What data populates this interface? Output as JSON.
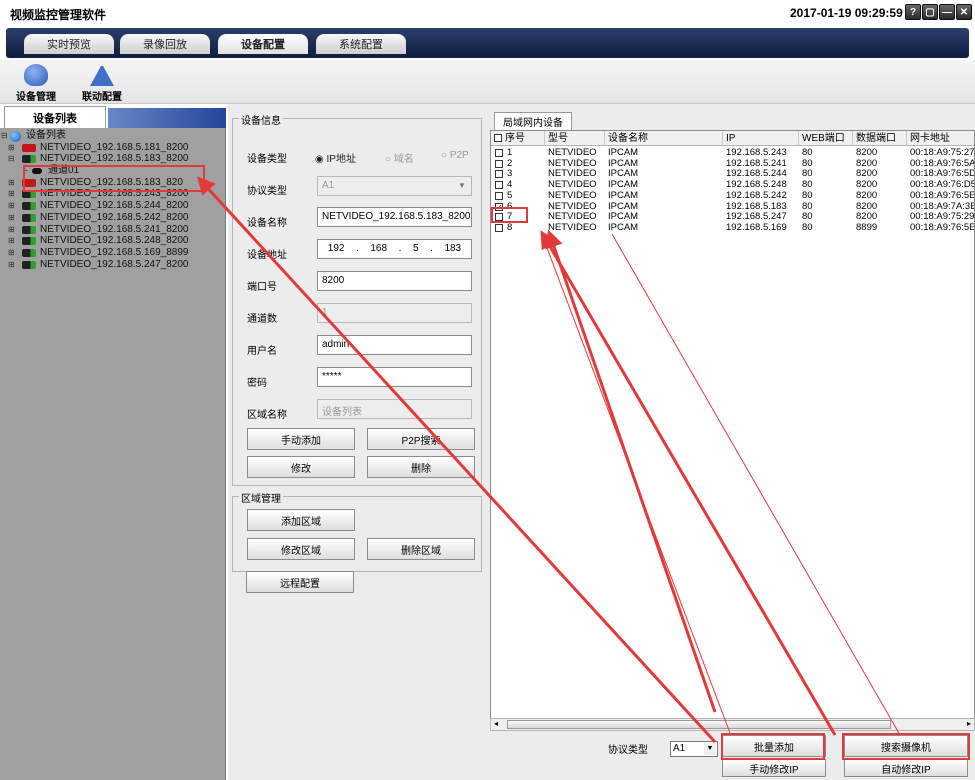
{
  "app": {
    "title": "视频监控管理软件",
    "datetime": "2017-01-19 09:29:59"
  },
  "window_buttons": [
    "?",
    "▢",
    "—",
    "✕"
  ],
  "tabs": [
    {
      "label": "实时预览"
    },
    {
      "label": "录像回放"
    },
    {
      "label": "设备配置"
    },
    {
      "label": "系统配置"
    }
  ],
  "toolbar": {
    "device_manage": "设备管理",
    "linkage_config": "联动配置"
  },
  "left": {
    "tab_label": "设备列表",
    "root": "设备列表",
    "devices": [
      {
        "name": "NETVIDEO_192.168.5.181_8200",
        "status": "red"
      },
      {
        "name": "NETVIDEO_192.168.5.183_8200",
        "status": "green"
      },
      {
        "name": "NETVIDEO_192.168.5.183_820",
        "status": "red"
      },
      {
        "name": "NETVIDEO_192.168.5.243_8200",
        "status": "green"
      },
      {
        "name": "NETVIDEO_192.168.5.244_8200",
        "status": "green"
      },
      {
        "name": "NETVIDEO_192.168.5.242_8200",
        "status": "green"
      },
      {
        "name": "NETVIDEO_192.168.5.241_8200",
        "status": "green"
      },
      {
        "name": "NETVIDEO_192.168.5.248_8200",
        "status": "green"
      },
      {
        "name": "NETVIDEO_192.168.5.169_8899",
        "status": "green"
      },
      {
        "name": "NETVIDEO_192.168.5.247_8200",
        "status": "green"
      }
    ],
    "channel": "通道01"
  },
  "device_info": {
    "group_title": "设备信息",
    "device_type_label": "设备类型",
    "type_ip": "IP地址",
    "type_domain": "域名",
    "type_p2p": "P2P",
    "protocol_label": "协议类型",
    "protocol_value": "A1",
    "name_label": "设备名称",
    "name_value": "NETVIDEO_192.168.5.183_8200",
    "address_label": "设备地址",
    "ip": [
      "192",
      "168",
      "5",
      "183"
    ],
    "port_label": "端口号",
    "port_value": "8200",
    "channels_label": "通道数",
    "channels_value": "1",
    "user_label": "用户名",
    "user_value": "admin",
    "password_label": "密码",
    "password_value": "*****",
    "area_label": "区域名称",
    "area_value": "设备列表",
    "btn_manual_add": "手动添加",
    "btn_p2p_search": "P2P搜索",
    "btn_modify": "修改",
    "btn_delete": "删除"
  },
  "area_mgmt": {
    "group_title": "区域管理",
    "btn_add": "添加区域",
    "btn_modify": "修改区域",
    "btn_delete": "删除区域"
  },
  "remote_config": "远程配置",
  "lan": {
    "tab_label": "局域网内设备",
    "columns": [
      "序号",
      "型号",
      "设备名称",
      "IP",
      "WEB端口",
      "数据端口",
      "网卡地址"
    ],
    "rows": [
      {
        "idx": "1",
        "model": "NETVIDEO",
        "name": "IPCAM",
        "ip": "192.168.5.243",
        "web": "80",
        "data": "8200",
        "mac": "00:18:A9:75:27",
        "checked": false
      },
      {
        "idx": "2",
        "model": "NETVIDEO",
        "name": "IPCAM",
        "ip": "192.168.5.241",
        "web": "80",
        "data": "8200",
        "mac": "00:18:A9:76:5A",
        "checked": false
      },
      {
        "idx": "3",
        "model": "NETVIDEO",
        "name": "IPCAM",
        "ip": "192.168.5.244",
        "web": "80",
        "data": "8200",
        "mac": "00:18:A9:76:5D",
        "checked": false
      },
      {
        "idx": "4",
        "model": "NETVIDEO",
        "name": "IPCAM",
        "ip": "192.168.5.248",
        "web": "80",
        "data": "8200",
        "mac": "00:18:A9:76:D5",
        "checked": false
      },
      {
        "idx": "5",
        "model": "NETVIDEO",
        "name": "IPCAM",
        "ip": "192.168.5.242",
        "web": "80",
        "data": "8200",
        "mac": "00:18:A9:76:5E",
        "checked": false
      },
      {
        "idx": "6",
        "model": "NETVIDEO",
        "name": "IPCAM",
        "ip": "192.168.5.183",
        "web": "80",
        "data": "8200",
        "mac": "00:18:A9:7A:3E",
        "checked": true
      },
      {
        "idx": "7",
        "model": "NETVIDEO",
        "name": "IPCAM",
        "ip": "192.168.5.247",
        "web": "80",
        "data": "8200",
        "mac": "00:18:A9:75:29",
        "checked": false
      },
      {
        "idx": "8",
        "model": "NETVIDEO",
        "name": "IPCAM",
        "ip": "192.168.5.169",
        "web": "80",
        "data": "8899",
        "mac": "00:18:A9:76:5E",
        "checked": false
      }
    ],
    "protocol_label": "协议类型",
    "protocol_value": "A1",
    "btn_batch_add": "批量添加",
    "btn_search_camera": "搜索摄像机",
    "btn_manual_modify_ip": "手动修改IP",
    "btn_auto_modify_ip": "自动修改IP"
  }
}
